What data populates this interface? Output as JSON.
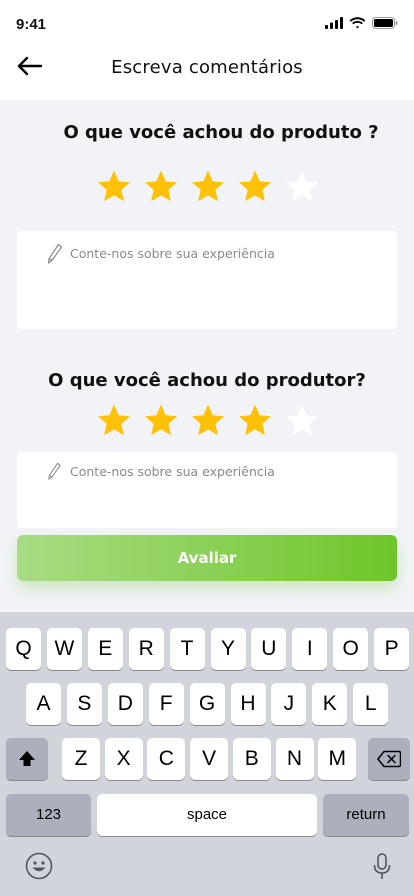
{
  "status_bar": {
    "time": "9:41"
  },
  "header": {
    "title": "Escreva comentários",
    "back_icon": "arrow-left-icon"
  },
  "product_review": {
    "question": "O que você achou do produto ?",
    "rating": 4,
    "max_rating": 5,
    "placeholder": "Conte-nos sobre sua experiência"
  },
  "producer_review": {
    "question": "O que você achou do produtor?",
    "rating": 4,
    "max_rating": 5,
    "placeholder": "Conte-nos sobre sua experiência"
  },
  "submit": {
    "label": "Avaliar"
  },
  "colors": {
    "star_filled": "#FFC107",
    "star_empty": "#FFFFFF",
    "button_start": "#A9DC85",
    "button_end": "#6EC62A"
  },
  "keyboard": {
    "row1": [
      "Q",
      "W",
      "E",
      "R",
      "T",
      "Y",
      "U",
      "I",
      "O",
      "P"
    ],
    "row2": [
      "A",
      "S",
      "D",
      "F",
      "G",
      "H",
      "J",
      "K",
      "L"
    ],
    "row3": [
      "Z",
      "X",
      "C",
      "V",
      "B",
      "N",
      "M"
    ],
    "numbers_label": "123",
    "space_label": "space",
    "return_label": "return"
  }
}
